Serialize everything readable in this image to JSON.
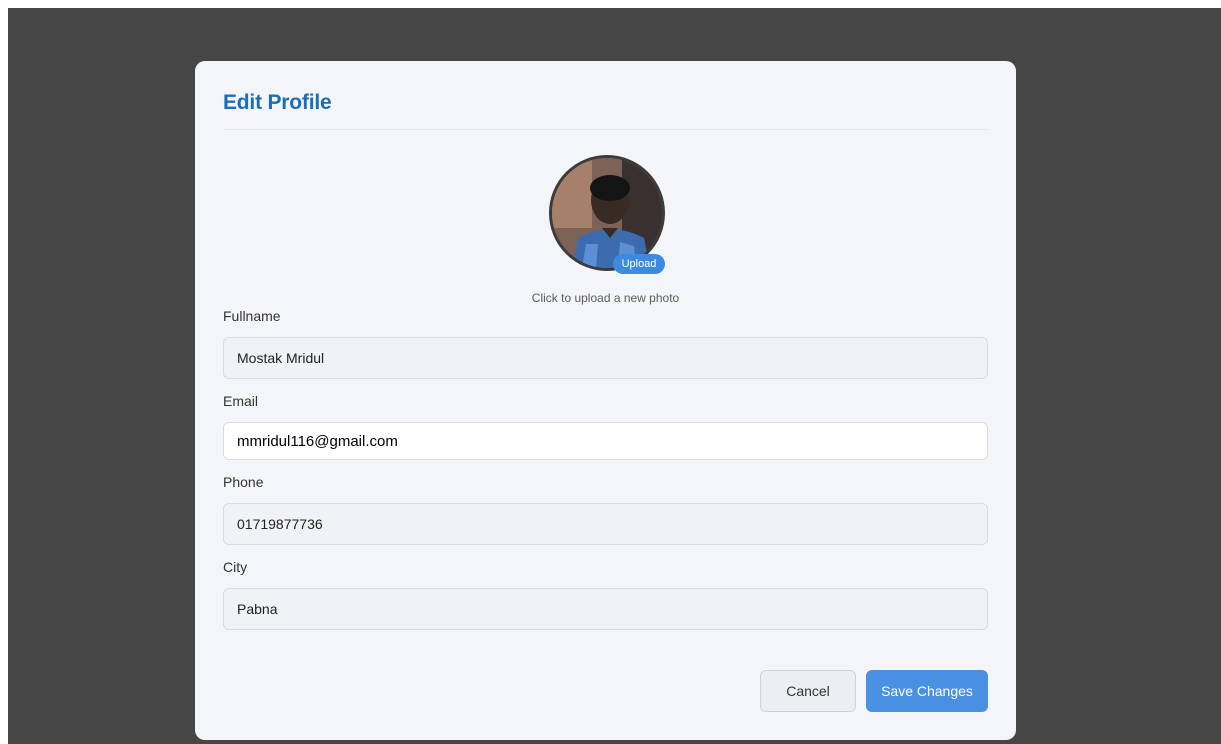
{
  "modal": {
    "title": "Edit Profile"
  },
  "avatar": {
    "upload_label": "Upload",
    "hint": "Click to upload a new photo"
  },
  "form": {
    "fullname": {
      "label": "Fullname",
      "value": "Mostak Mridul"
    },
    "email": {
      "label": "Email",
      "value": "mmridul116@gmail.com"
    },
    "phone": {
      "label": "Phone",
      "value": "01719877736"
    },
    "city": {
      "label": "City",
      "value": "Pabna"
    }
  },
  "buttons": {
    "cancel": "Cancel",
    "save": "Save Changes"
  },
  "colors": {
    "title": "#1b6eb5",
    "primary": "#4a90e2",
    "overlay": "#464646",
    "modal_bg": "#f4f5f9"
  }
}
